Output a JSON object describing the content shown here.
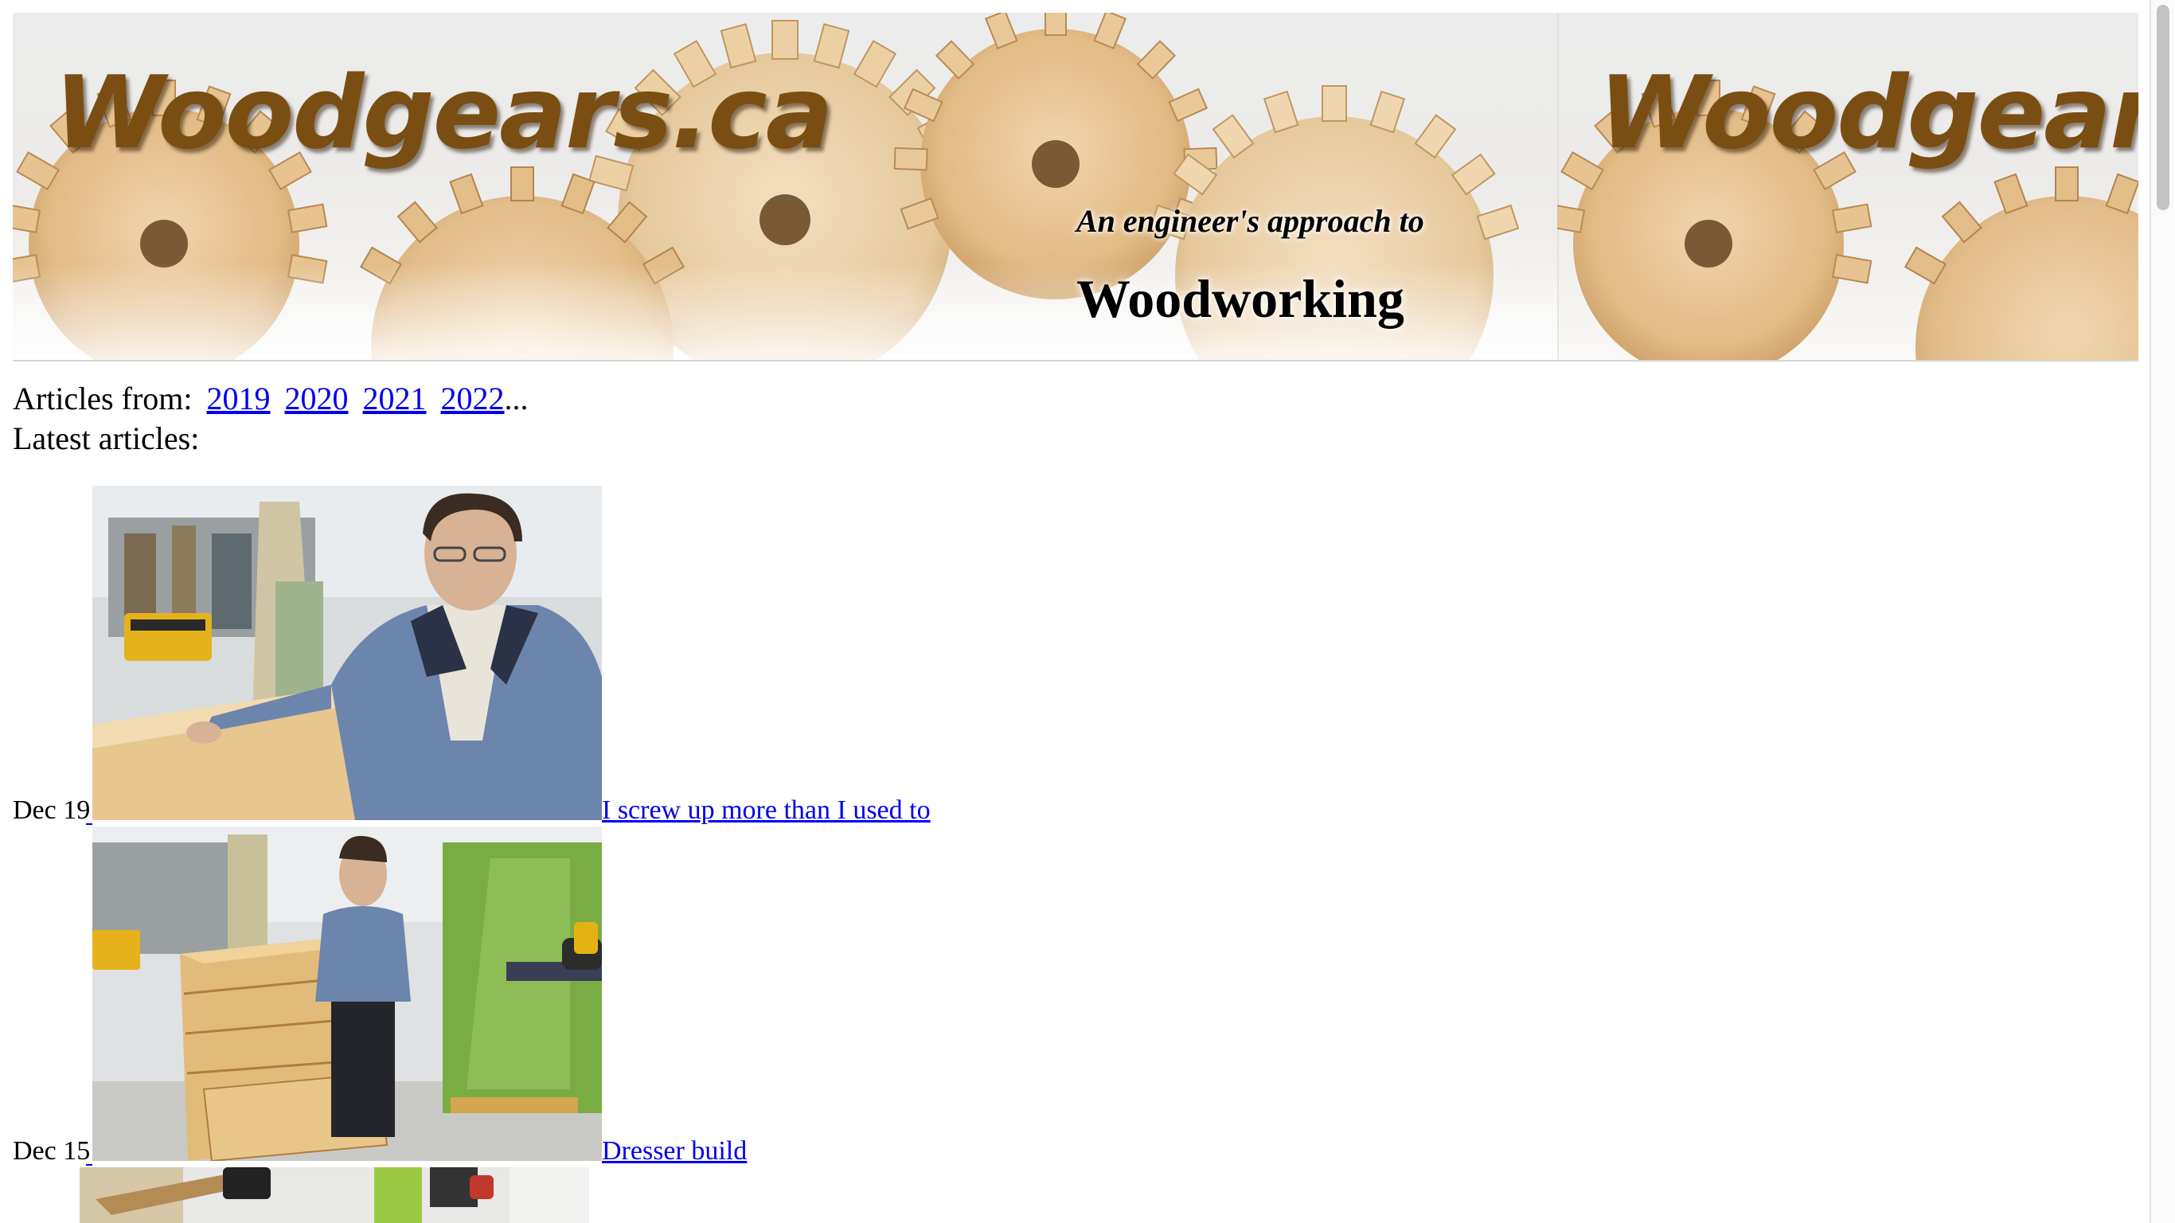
{
  "banner": {
    "logo_text": "Woodgears.ca",
    "tagline": "An engineer's approach to",
    "subject": "Woodworking"
  },
  "year_nav": {
    "label": "Articles from:",
    "years": [
      "2019",
      "2020",
      "2021",
      "2022"
    ],
    "ellipsis": "..."
  },
  "latest_heading": "Latest articles:",
  "articles": [
    {
      "date": "Dec 19",
      "title": "I screw up more than I used to"
    },
    {
      "date": "Dec 15",
      "title": "Dresser build"
    }
  ],
  "colors": {
    "link": "#0000ee",
    "logo_brown": "#7a4e12",
    "wood_light": "#e8c898",
    "wood_dark": "#b98a55"
  }
}
